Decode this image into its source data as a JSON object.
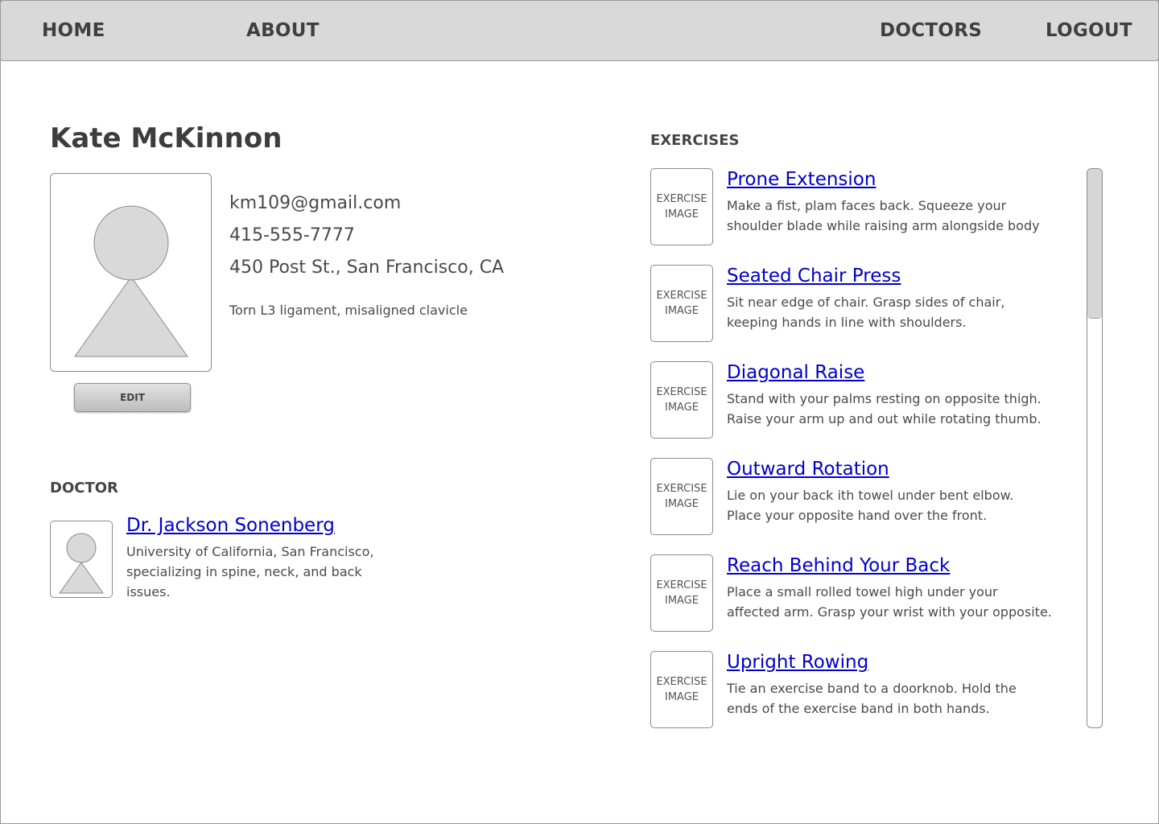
{
  "nav": {
    "home": "HOME",
    "about": "ABOUT",
    "doctors": "DOCTORS",
    "logout": "LOGOUT"
  },
  "patient": {
    "name": "Kate McKinnon",
    "email": "km109@gmail.com",
    "phone": "415-555-7777",
    "address": "450 Post St., San Francisco, CA",
    "condition": "Torn L3 ligament, misaligned clavicle",
    "edit_label": "EDIT"
  },
  "doctor_section": {
    "label": "DOCTOR",
    "name": "Dr. Jackson Sonenberg",
    "description_lines": [
      "University of California, San Francisco,",
      "specializing in  spine, neck, and back",
      "issues."
    ]
  },
  "exercises_section": {
    "label": "EXERCISES",
    "image_placeholder": [
      "EXERCISE",
      "IMAGE"
    ],
    "items": [
      {
        "title": "Prone Extension",
        "lines": [
          "Make a fist, plam faces back.  Squeeze your",
          "shoulder blade while raising arm alongside body"
        ]
      },
      {
        "title": "Seated Chair Press",
        "lines": [
          "Sit near edge of chair.  Grasp sides of chair,",
          "keeping hands in line with shoulders."
        ]
      },
      {
        "title": "Diagonal Raise",
        "lines": [
          "Stand with your palms resting on opposite thigh.",
          "Raise your arm up and out while rotating thumb."
        ]
      },
      {
        "title": "Outward Rotation",
        "lines": [
          "Lie on your back ith towel under bent elbow.",
          "Place your opposite hand  over the front."
        ]
      },
      {
        "title": "Reach Behind Your Back",
        "lines": [
          "Place a small rolled towel high under your",
          "affected arm. Grasp your wrist with your opposite."
        ]
      },
      {
        "title": "Upright Rowing",
        "lines": [
          "Tie an exercise band to a doorknob.  Hold the",
          "ends of the exercise band in both hands."
        ]
      }
    ]
  },
  "colors": {
    "nav_bg": "#d9d9d9",
    "link": "#0000cc",
    "placeholder_fill": "#d9d9d9"
  }
}
